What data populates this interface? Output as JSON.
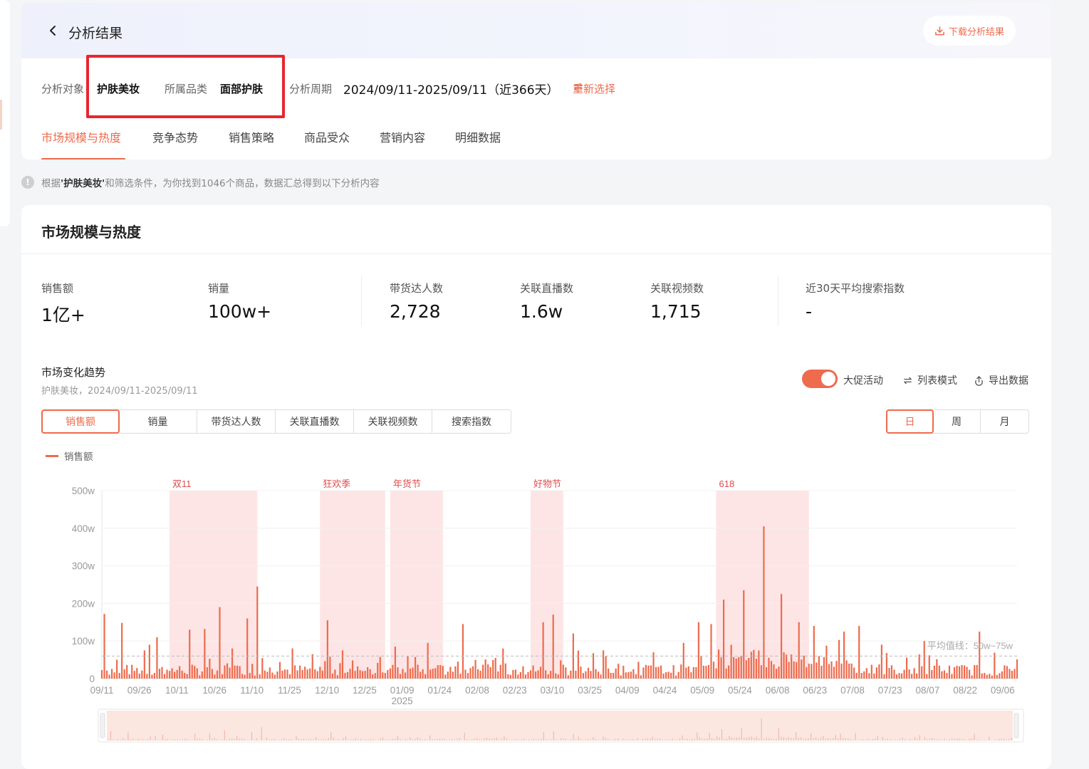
{
  "header": {
    "title": "分析结果",
    "download_label": "下载分析结果"
  },
  "meta": {
    "target_label": "分析对象",
    "target_value": "护肤美妆",
    "category_label": "所属品类",
    "category_value": "面部护肤",
    "period_label": "分析周期",
    "period_value": "2024/09/11-2025/09/11（近366天）",
    "reselect_label": "重新选择"
  },
  "tabs": [
    {
      "label": "市场规模与热度",
      "active": true
    },
    {
      "label": "竞争态势"
    },
    {
      "label": "销售策略"
    },
    {
      "label": "商品受众"
    },
    {
      "label": "营销内容"
    },
    {
      "label": "明细数据"
    }
  ],
  "info": {
    "prefix": "根据",
    "keyword": "'护肤美妆'",
    "suffix": "和筛选条件，为你找到1046个商品，数据汇总得到以下分析内容"
  },
  "section": {
    "title": "市场规模与热度"
  },
  "stats": [
    {
      "label": "销售额",
      "value": "1亿+"
    },
    {
      "label": "销量",
      "value": "100w+"
    },
    {
      "label": "带货达人数",
      "value": "2,728"
    },
    {
      "label": "关联直播数",
      "value": "1.6w"
    },
    {
      "label": "关联视频数",
      "value": "1,715"
    },
    {
      "label": "近30天平均搜索指数",
      "value": "-"
    }
  ],
  "trend": {
    "title": "市场变化趋势",
    "subtitle": "护肤美妆，2024/09/11-2025/09/11",
    "promo_label": "大促活动",
    "promo_on": true,
    "list_mode_label": "列表模式",
    "export_label": "导出数据",
    "metric_tabs": [
      "销售额",
      "销量",
      "带货达人数",
      "关联直播数",
      "关联视频数",
      "搜索指数"
    ],
    "active_metric": "销售额",
    "period_tabs": [
      "日",
      "周",
      "月"
    ],
    "active_period": "日",
    "legend": "销售额"
  },
  "colors": {
    "accent": "#ee6b4d",
    "promo_band": "#fde5e5",
    "highlight": "#e8262e"
  },
  "chart_data": {
    "type": "bar",
    "series_name": "销售额",
    "y_ticks": [
      "0",
      "100w",
      "200w",
      "300w",
      "400w",
      "500w"
    ],
    "ylim": [
      0,
      500
    ],
    "y_unit": "w",
    "x_ticks": [
      "09/11",
      "09/26",
      "10/11",
      "10/26",
      "11/10",
      "11/25",
      "12/10",
      "12/25",
      "01/09",
      "01/24",
      "02/08",
      "02/23",
      "03/10",
      "03/25",
      "04/09",
      "04/24",
      "05/09",
      "05/24",
      "06/08",
      "06/23",
      "07/08",
      "07/23",
      "08/07",
      "08/22",
      "09/06"
    ],
    "x_year_label": {
      "tick": "01/09",
      "label": "2025"
    },
    "day_count": 366,
    "promo_periods": [
      {
        "label": "双11",
        "start_day": 27,
        "end_day": 62
      },
      {
        "label": "狂欢季",
        "start_day": 87,
        "end_day": 113
      },
      {
        "label": "年货节",
        "start_day": 115,
        "end_day": 136
      },
      {
        "label": "好物节",
        "start_day": 171,
        "end_day": 184
      },
      {
        "label": "618",
        "start_day": 245,
        "end_day": 282
      }
    ],
    "average_line": {
      "label": "平均值线：50w~75w",
      "value": 60
    },
    "peaks": [
      {
        "day": 1,
        "value": 172
      },
      {
        "day": 8,
        "value": 148
      },
      {
        "day": 17,
        "value": 75
      },
      {
        "day": 19,
        "value": 90
      },
      {
        "day": 22,
        "value": 110
      },
      {
        "day": 35,
        "value": 130
      },
      {
        "day": 41,
        "value": 132
      },
      {
        "day": 47,
        "value": 190
      },
      {
        "day": 52,
        "value": 80
      },
      {
        "day": 58,
        "value": 160
      },
      {
        "day": 62,
        "value": 245
      },
      {
        "day": 76,
        "value": 80
      },
      {
        "day": 90,
        "value": 155
      },
      {
        "day": 96,
        "value": 75
      },
      {
        "day": 117,
        "value": 85
      },
      {
        "day": 130,
        "value": 95
      },
      {
        "day": 144,
        "value": 145
      },
      {
        "day": 160,
        "value": 80
      },
      {
        "day": 176,
        "value": 150
      },
      {
        "day": 180,
        "value": 170
      },
      {
        "day": 188,
        "value": 120
      },
      {
        "day": 200,
        "value": 75
      },
      {
        "day": 220,
        "value": 70
      },
      {
        "day": 232,
        "value": 95
      },
      {
        "day": 238,
        "value": 150
      },
      {
        "day": 243,
        "value": 145
      },
      {
        "day": 248,
        "value": 210
      },
      {
        "day": 251,
        "value": 90
      },
      {
        "day": 256,
        "value": 235
      },
      {
        "day": 264,
        "value": 405
      },
      {
        "day": 271,
        "value": 225
      },
      {
        "day": 278,
        "value": 150
      },
      {
        "day": 284,
        "value": 140
      },
      {
        "day": 296,
        "value": 125
      },
      {
        "day": 302,
        "value": 140
      },
      {
        "day": 311,
        "value": 90
      },
      {
        "day": 328,
        "value": 100
      },
      {
        "day": 350,
        "value": 125
      }
    ]
  }
}
